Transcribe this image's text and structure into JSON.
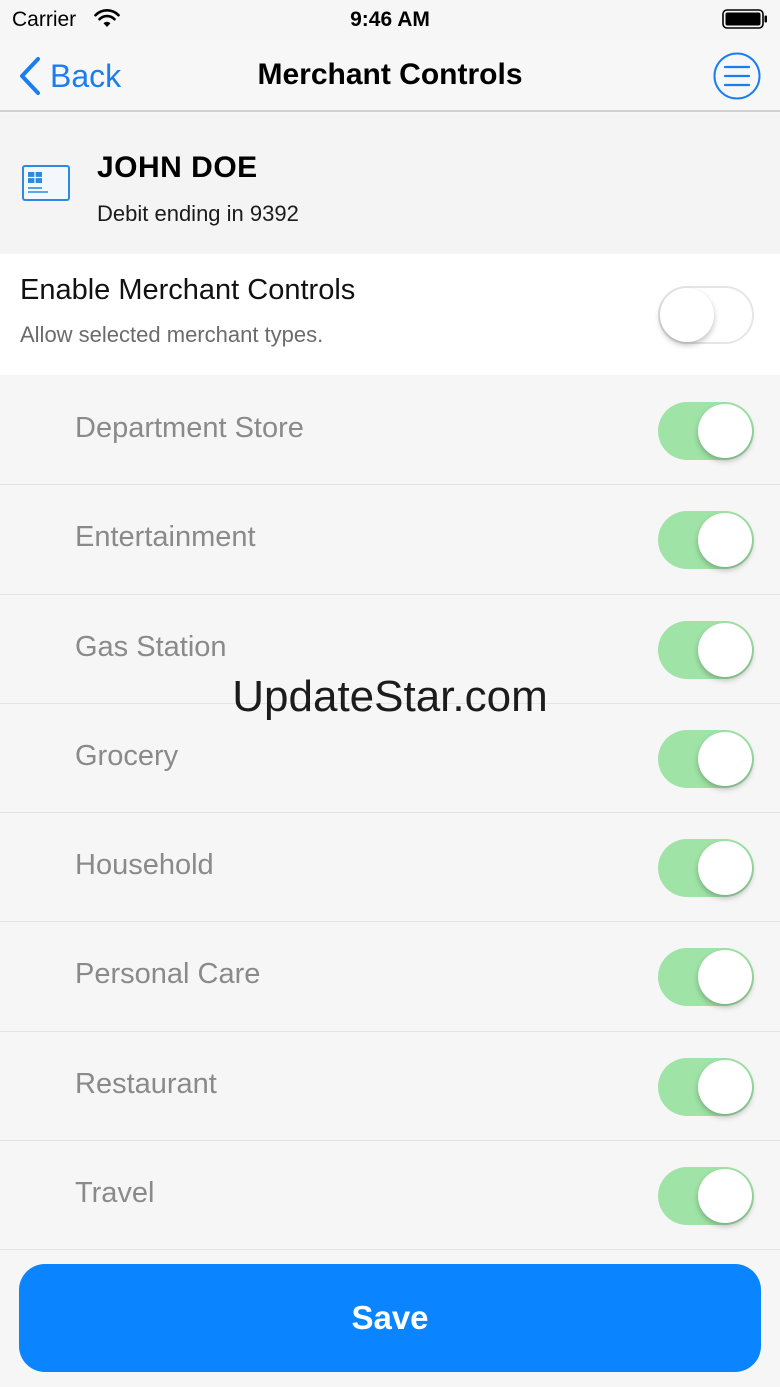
{
  "status_bar": {
    "carrier": "Carrier",
    "time": "9:46 AM"
  },
  "nav": {
    "back_label": "Back",
    "title": "Merchant Controls"
  },
  "card": {
    "holder_name": "JOHN DOE",
    "subtitle": "Debit ending in 9392"
  },
  "enable": {
    "title": "Enable Merchant Controls",
    "subtitle": "Allow selected merchant types.",
    "enabled": false
  },
  "merchants": [
    {
      "label": "Department Store",
      "enabled": true
    },
    {
      "label": "Entertainment",
      "enabled": true
    },
    {
      "label": "Gas Station",
      "enabled": true
    },
    {
      "label": "Grocery",
      "enabled": true
    },
    {
      "label": "Household",
      "enabled": true
    },
    {
      "label": "Personal Care",
      "enabled": true
    },
    {
      "label": "Restaurant",
      "enabled": true
    },
    {
      "label": "Travel",
      "enabled": true
    }
  ],
  "watermark": "UpdateStar.com",
  "save_label": "Save",
  "colors": {
    "accent": "#0a84ff",
    "toggle_on": "#9fe4a6",
    "toggle_off": "#ffffff"
  }
}
